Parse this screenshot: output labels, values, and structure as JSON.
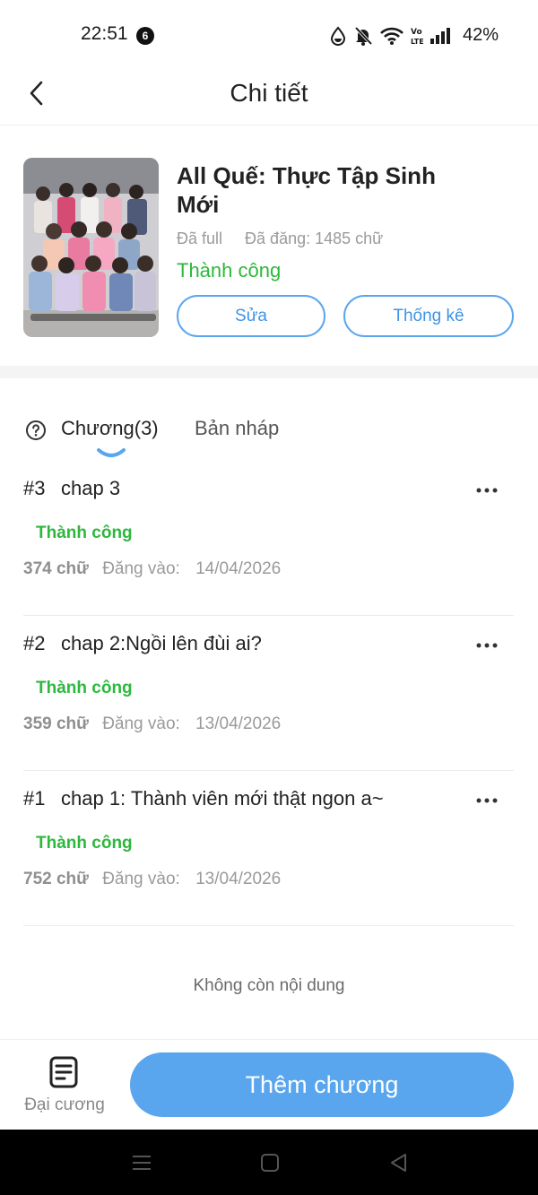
{
  "status_bar": {
    "time": "22:51",
    "notification_count": "6",
    "battery": "42%",
    "icons": [
      "water-drop-icon",
      "bell-off-icon",
      "wifi-icon",
      "volte-icon",
      "signal-icon"
    ]
  },
  "header": {
    "title": "Chi tiết",
    "back_icon": "chevron-left-icon"
  },
  "book": {
    "title": "All Quế: Thực Tập Sinh Mới",
    "completion": "Đã full",
    "published_words": "Đã đăng: 1485 chữ",
    "status": "Thành  công",
    "edit_label": "Sửa",
    "stats_label": "Thống kê"
  },
  "tabs": {
    "chapters_label": "Chương(3)",
    "drafts_label": "Bản nháp"
  },
  "chapters": [
    {
      "number": "#3",
      "title": "chap 3",
      "status": "Thành công",
      "words": "374 chữ",
      "date_label": "Đăng vào:",
      "date": "14/04/2026"
    },
    {
      "number": "#2",
      "title": "chap 2:Ngồi lên đùi ai?",
      "status": "Thành công",
      "words": "359 chữ",
      "date_label": "Đăng vào:",
      "date": "13/04/2026"
    },
    {
      "number": "#1",
      "title": "chap 1: Thành viên mới thật ngon a~",
      "status": "Thành công",
      "words": "752 chữ",
      "date_label": "Đăng vào:",
      "date": "13/04/2026"
    }
  ],
  "end_of_list": "Không còn nội dung",
  "bottom_bar": {
    "outline_label": "Đại cương",
    "add_chapter_label": "Thêm chương"
  },
  "colors": {
    "accent_blue": "#5aa6ee",
    "success_green": "#2db83d",
    "muted_gray": "#9a9a9a"
  }
}
